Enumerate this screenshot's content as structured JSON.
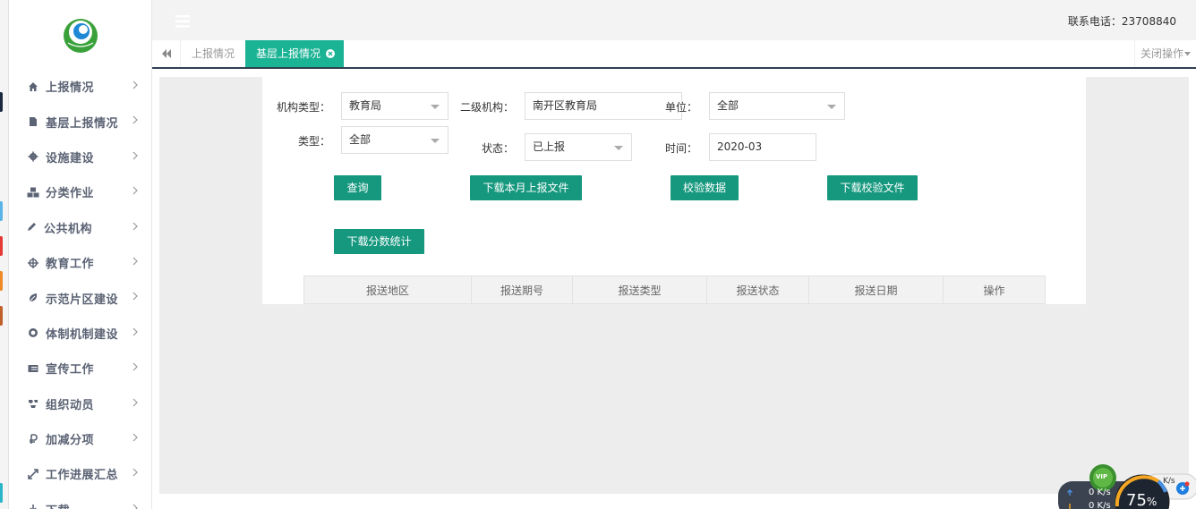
{
  "header": {
    "phone_text": "联系电话：23708840"
  },
  "sidebar": {
    "items": [
      {
        "label": "上报情况",
        "icon": "home-icon"
      },
      {
        "label": "基层上报情况",
        "icon": "file-icon"
      },
      {
        "label": "设施建设",
        "icon": "gear-icon"
      },
      {
        "label": "分类作业",
        "icon": "cubes-icon"
      },
      {
        "label": "公共机构",
        "icon": "pencil-icon"
      },
      {
        "label": "教育工作",
        "icon": "crosshair-icon"
      },
      {
        "label": "示范片区建设",
        "icon": "leaf-icon"
      },
      {
        "label": "体制机制建设",
        "icon": "lifebuoy-icon"
      },
      {
        "label": "宣传工作",
        "icon": "list-icon"
      },
      {
        "label": "组织动员",
        "icon": "recycle-icon"
      },
      {
        "label": "加减分项",
        "icon": "ruble-icon"
      },
      {
        "label": "工作进展汇总",
        "icon": "expand-icon"
      },
      {
        "label": "下载",
        "icon": "download-icon"
      }
    ]
  },
  "tabs": {
    "inactive_label": "上报情况",
    "active_label": "基层上报情况",
    "close_ops_label": "关闭操作"
  },
  "form": {
    "org_type_label": "机构类型：",
    "org_type_value": "教育局",
    "secondary_org_label": "二级机构：",
    "secondary_org_value": "南开区教育局",
    "unit_label": "单位：",
    "unit_value": "全部",
    "type_label": "类型：",
    "type_value": "全部",
    "status_label": "状态：",
    "status_value": "已上报",
    "time_label": "时间：",
    "time_value": "2020-03"
  },
  "buttons": {
    "query": "查询",
    "download_monthly": "下载本月上报文件",
    "verify_data": "校验数据",
    "download_verify": "下载校验文件",
    "download_score": "下载分数统计"
  },
  "table": {
    "columns": [
      "报送地区",
      "报送期号",
      "报送类型",
      "报送状态",
      "报送日期",
      "操作"
    ]
  },
  "speed_widget": {
    "up": "0 K/s",
    "down": "0 K/s",
    "percent": "75",
    "percent_sign": "%",
    "vip": "VIP",
    "side_up": "K/s"
  },
  "colors": {
    "accent": "#1ab394",
    "button": "#16987e",
    "sidebar_text": "#5b6374",
    "dark_navy": "#2f4050"
  }
}
